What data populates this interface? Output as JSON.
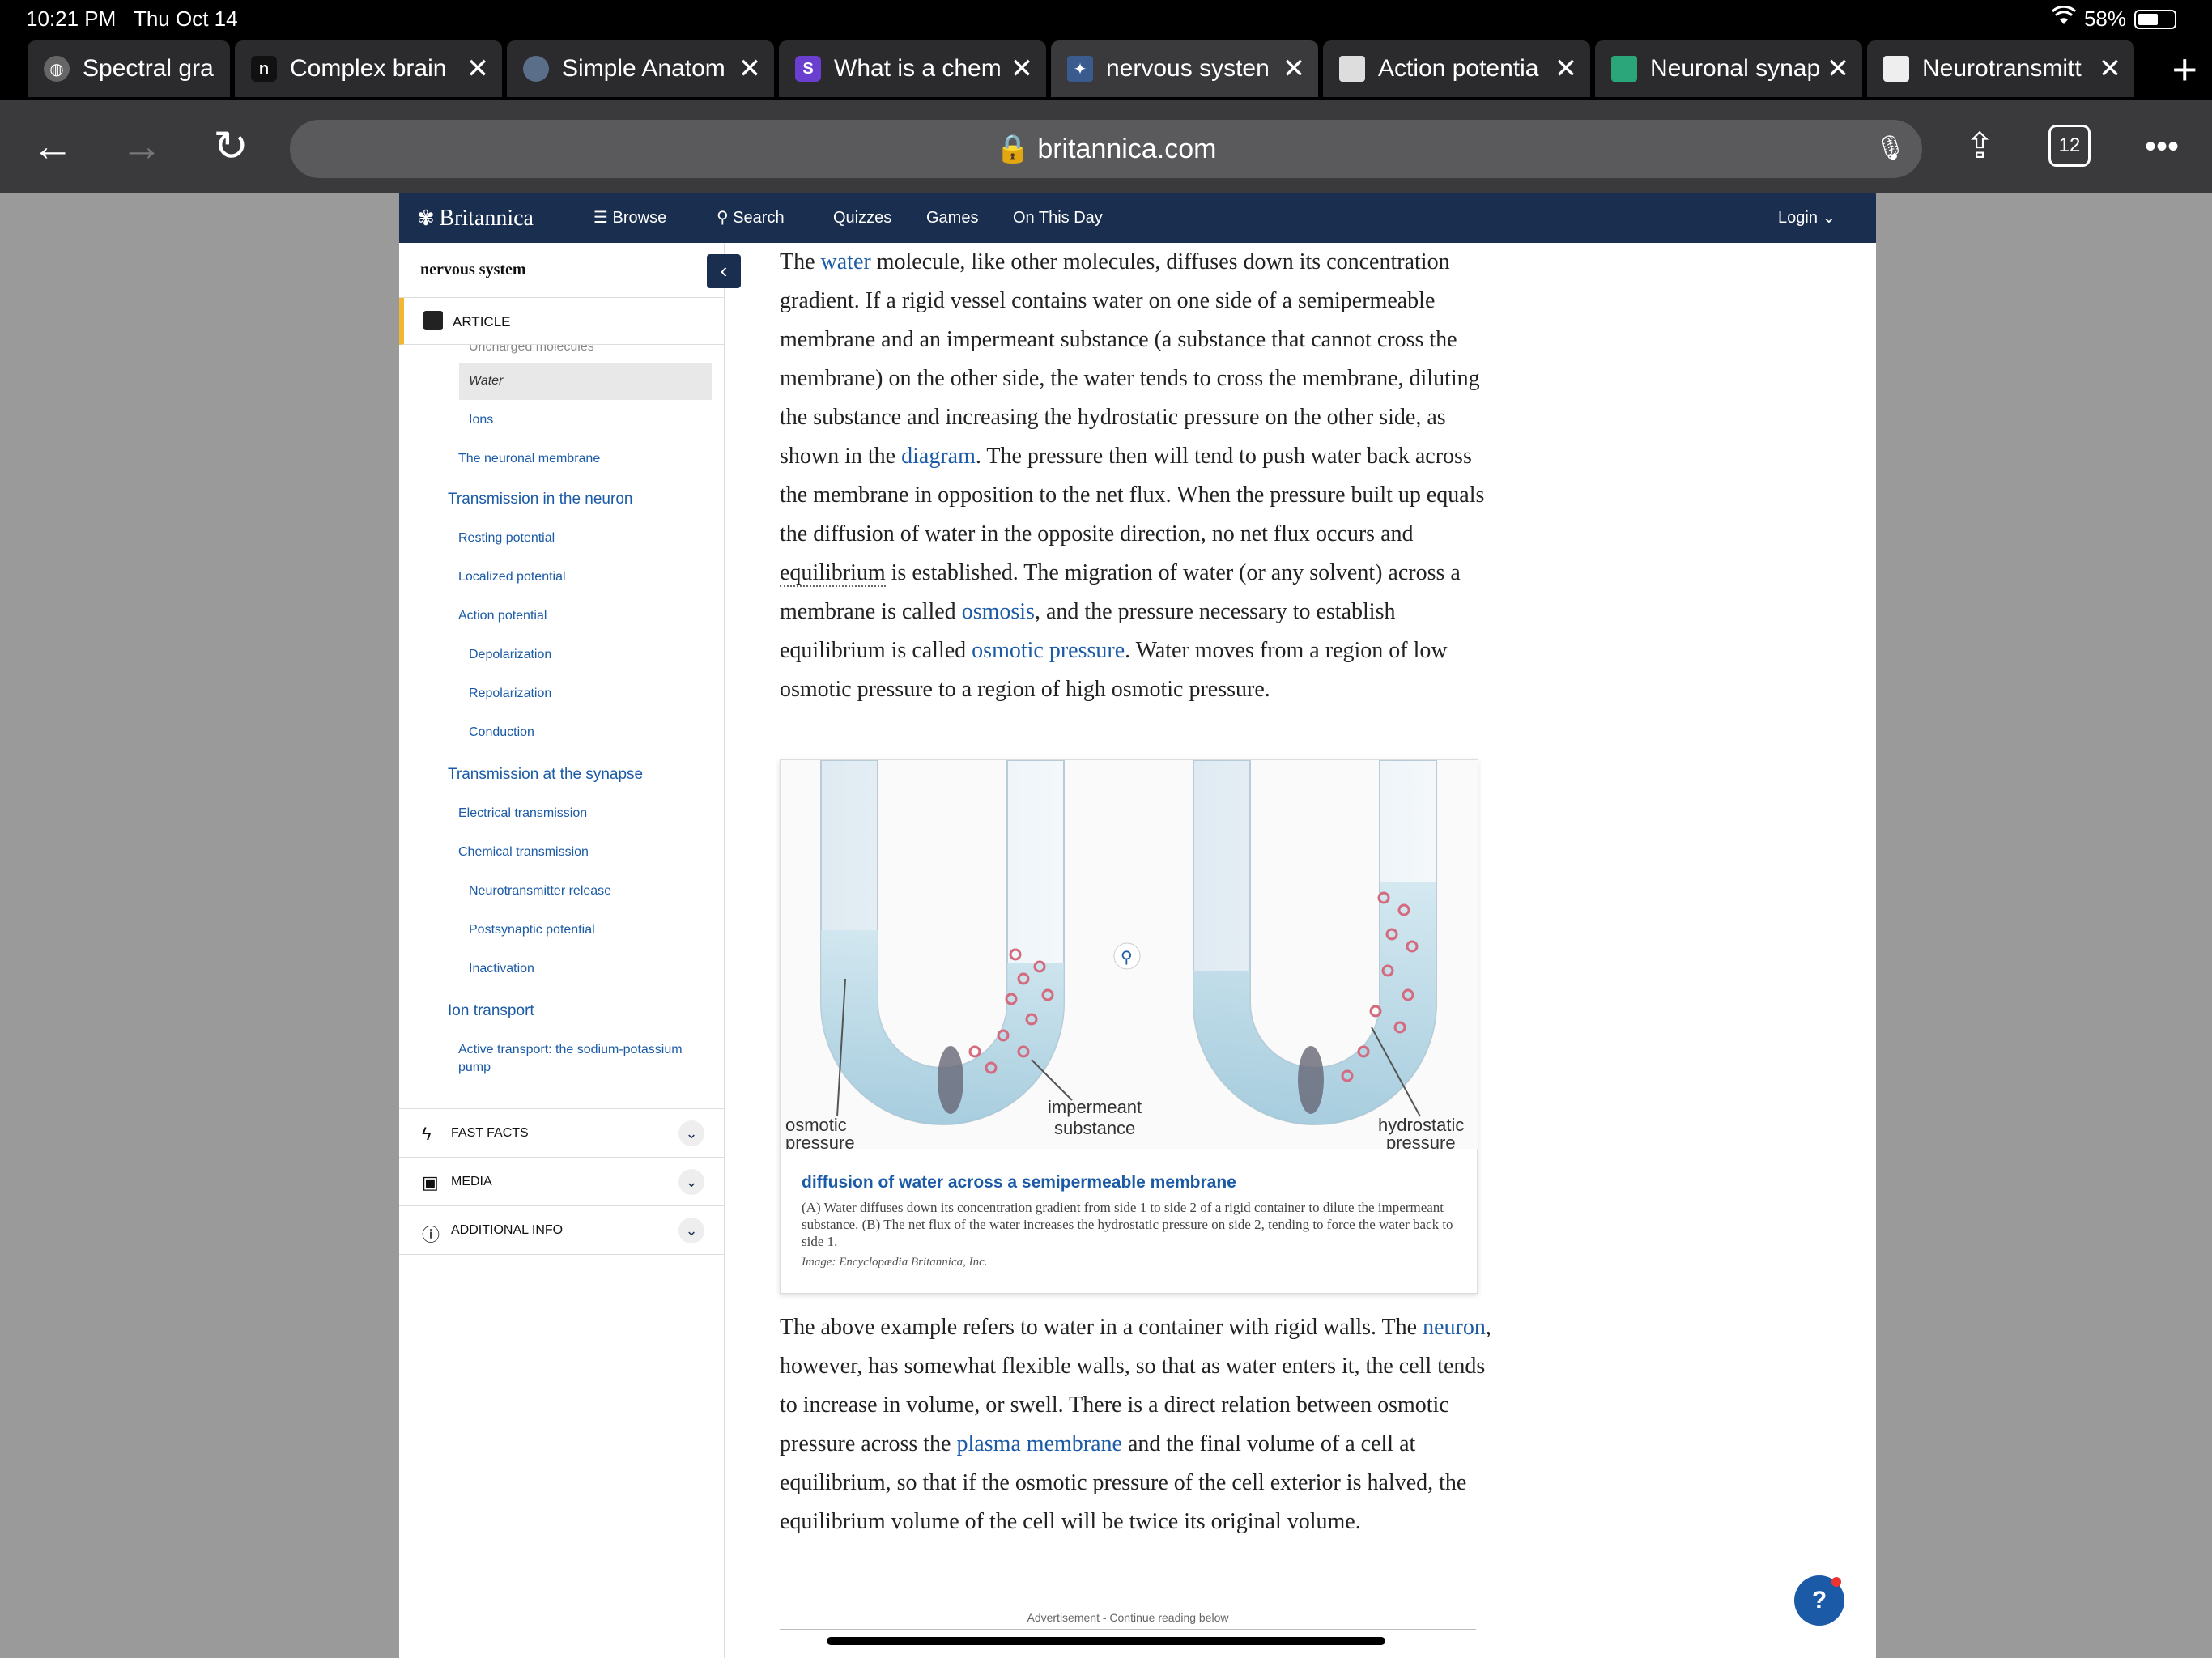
{
  "status": {
    "time": "10:21 PM",
    "date": "Thu Oct 14",
    "battery": "58%"
  },
  "tabs": [
    {
      "title": "Spectral gra",
      "icon": "globe-icon"
    },
    {
      "title": "Complex brain",
      "icon": "notion-icon",
      "glyph": "n"
    },
    {
      "title": "Simple Anatom",
      "icon": "anatomy-icon"
    },
    {
      "title": "What is a chem",
      "icon": "s-logo-icon",
      "glyph": "S"
    },
    {
      "title": "nervous systen",
      "icon": "britannica-icon"
    },
    {
      "title": "Action potentia",
      "icon": "university-icon"
    },
    {
      "title": "Neuronal synap",
      "icon": "shield-icon"
    },
    {
      "title": "Neurotransmitt",
      "icon": "wave-icon"
    }
  ],
  "tab_count": "12",
  "url": "🔒 britannica.com",
  "nav": {
    "brand": "Britannica",
    "browse": "Browse",
    "search": "Search",
    "quizzes": "Quizzes",
    "games": "Games",
    "on_this_day": "On This Day",
    "login": "Login"
  },
  "sidebar": {
    "title": "nervous system",
    "article_label": "ARTICLE",
    "toc": [
      {
        "label": "Uncharged molecules",
        "level": 3
      },
      {
        "label": "Water",
        "level": 3,
        "current": true
      },
      {
        "label": "Ions",
        "level": 3
      },
      {
        "label": "The neuronal membrane",
        "level": 2
      },
      {
        "label": "Transmission in the neuron",
        "level": 1
      },
      {
        "label": "Resting potential",
        "level": 2
      },
      {
        "label": "Localized potential",
        "level": 2
      },
      {
        "label": "Action potential",
        "level": 2
      },
      {
        "label": "Depolarization",
        "level": 3
      },
      {
        "label": "Repolarization",
        "level": 3
      },
      {
        "label": "Conduction",
        "level": 3
      },
      {
        "label": "Transmission at the synapse",
        "level": 1
      },
      {
        "label": "Electrical transmission",
        "level": 2
      },
      {
        "label": "Chemical transmission",
        "level": 2
      },
      {
        "label": "Neurotransmitter release",
        "level": 3
      },
      {
        "label": "Postsynaptic potential",
        "level": 3
      },
      {
        "label": "Inactivation",
        "level": 3
      },
      {
        "label": "Ion transport",
        "level": 1
      },
      {
        "label": "Active transport: the sodium-potassium",
        "level": 2
      },
      {
        "label": "pump",
        "level": 2
      }
    ],
    "sections": [
      "FAST FACTS",
      "MEDIA",
      "ADDITIONAL INFO"
    ]
  },
  "article": {
    "p1": {
      "a": "The ",
      "water": "water",
      "b": " molecule, like other molecules, diffuses down its concentration gradient. If a rigid vessel contains water on one side of a semipermeable membrane and an impermeant substance (a substance that cannot cross the membrane) on the other side, the water tends to cross the membrane, diluting the substance and increasing the hydrostatic pressure on the other side, as shown in the ",
      "diagram": "diagram",
      "c": ". The pressure then will tend to push water back across the membrane in opposition to the net flux. When the pressure built up equals the diffusion of water in the opposite direction, no net flux occurs and ",
      "equilibrium": "equilibrium",
      "d": " is established. The migration of water (or any solvent) across a membrane is called ",
      "osmosis": "osmosis",
      "e": ", and the pressure necessary to establish equilibrium is called ",
      "osmotic_pressure": "osmotic pressure",
      "f": ". Water moves from a region of low osmotic pressure to a region of high osmotic pressure."
    },
    "figure": {
      "labels": {
        "osmotic": "osmotic",
        "pressure": "pressure",
        "impermeant": "impermeant",
        "substance": "substance",
        "hydrostatic": "hydrostatic",
        "pressure2": "pressure"
      },
      "title": "diffusion of water across a semipermeable membrane",
      "caption": "(A) Water diffuses down its concentration gradient from side 1 to side 2 of a rigid container to dilute the impermeant substance. (B) The net flux of the water increases the hydrostatic pressure on side 2, tending to force the water back to side 1.",
      "credit": "Image: Encyclopædia Britannica, Inc."
    },
    "p2": {
      "a": "The above example refers to water in a container with rigid walls. The ",
      "neuron": "neuron",
      "b": ", however, has somewhat flexible walls, so that as water enters it, the cell tends to increase in volume, or swell. There is a direct relation between osmotic pressure across the ",
      "plasma_membrane": "plasma membrane",
      "c": " and the final volume of a cell at equilibrium, so that if the osmotic pressure of the cell exterior is halved, the equilibrium volume of the cell will be twice its original volume."
    },
    "ad": "Advertisement - Continue reading below"
  },
  "colors": {
    "nav_bg": "#1a2e4f",
    "link": "#1a5aa6",
    "accent": "#f2b630"
  }
}
